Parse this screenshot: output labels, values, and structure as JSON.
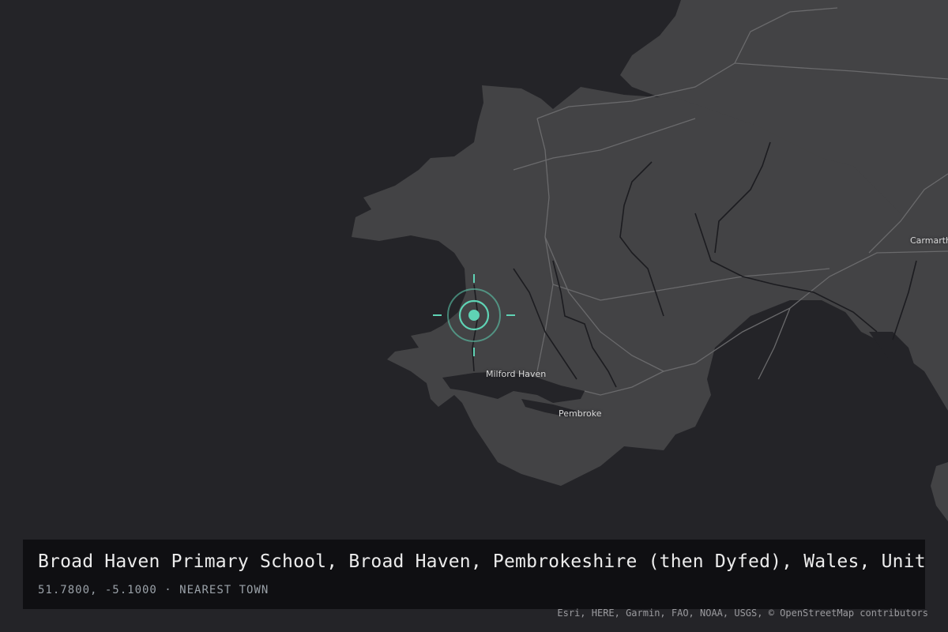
{
  "map": {
    "place_labels": {
      "milford_haven": "Milford Haven",
      "pembroke": "Pembroke",
      "carmarthen": "Carmarth"
    },
    "marker_icon": "target-crosshair-icon",
    "colors": {
      "sea": "#242428",
      "land": "#434345",
      "roads": "#6a6a6c",
      "rivers": "#1c1c20",
      "marker": "#5fd3b5"
    }
  },
  "info": {
    "title": "Broad Haven Primary School, Broad Haven, Pembrokeshire (then Dyfed), Wales, United Kingdom",
    "coordinates": "51.7800, -5.1000",
    "separator": "·",
    "precision": "NEAREST TOWN"
  },
  "attribution": "Esri, HERE, Garmin, FAO, NOAA, USGS, © OpenStreetMap contributors"
}
